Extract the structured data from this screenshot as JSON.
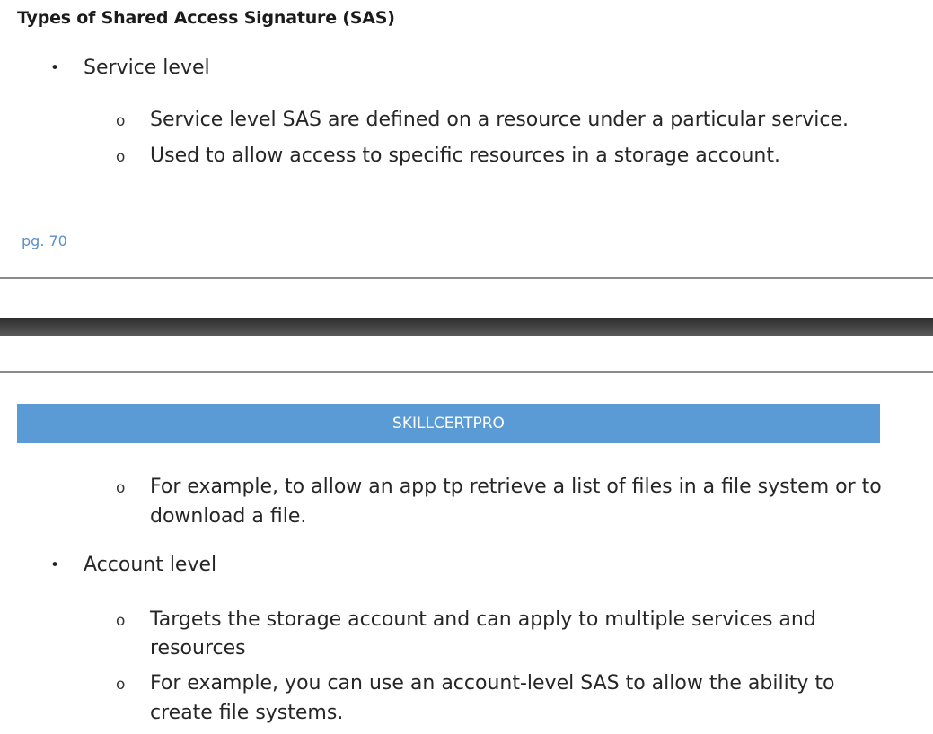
{
  "document": {
    "section_heading": "Types of Shared Access Signature (SAS)",
    "bullet_marker": "•",
    "sub_marker": "o",
    "service_level": {
      "label": "Service level",
      "items": [
        "Service level SAS are defined on a resource under a particular service.",
        "Used to allow access to specific resources in a storage account."
      ]
    },
    "page_number": "pg. 70",
    "header_banner": "SKILLCERTPRO",
    "continued_item": {
      "line1": "For example, to allow an app tp retrieve a list of files in a file system or to",
      "line2": "download a file."
    },
    "account_level": {
      "label": "Account level",
      "items": [
        {
          "line1": "Targets the storage account and can apply to multiple services and",
          "line2": "resources"
        },
        {
          "line1": "For example, you can use an account-level SAS to allow the ability to",
          "line2": "create file systems."
        }
      ]
    }
  },
  "colors": {
    "banner_background": "#5b9bd5",
    "banner_text": "#ffffff",
    "page_number": "#5b8fc7",
    "heading": "#1b1b1b"
  }
}
